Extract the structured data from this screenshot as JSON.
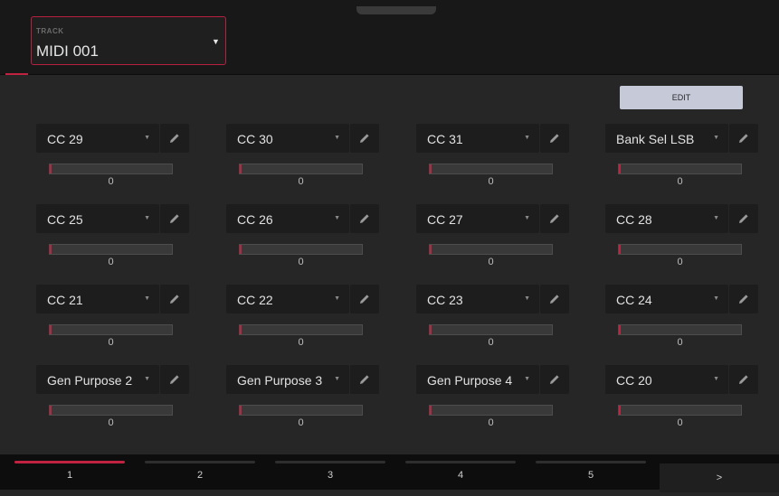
{
  "track": {
    "label": "TRACK",
    "value": "MIDI 001"
  },
  "edit_label": "EDIT",
  "rows": [
    [
      {
        "name": "CC 29",
        "value": "0",
        "level": 0
      },
      {
        "name": "CC 30",
        "value": "0",
        "level": 0
      },
      {
        "name": "CC 31",
        "value": "0",
        "level": 0
      },
      {
        "name": "Bank Sel LSB",
        "value": "0",
        "level": 0
      }
    ],
    [
      {
        "name": "CC 25",
        "value": "0",
        "level": 0
      },
      {
        "name": "CC 26",
        "value": "0",
        "level": 0
      },
      {
        "name": "CC 27",
        "value": "0",
        "level": 0
      },
      {
        "name": "CC 28",
        "value": "0",
        "level": 0
      }
    ],
    [
      {
        "name": "CC 21",
        "value": "0",
        "level": 0
      },
      {
        "name": "CC 22",
        "value": "0",
        "level": 0
      },
      {
        "name": "CC 23",
        "value": "0",
        "level": 0
      },
      {
        "name": "CC 24",
        "value": "0",
        "level": 0
      }
    ],
    [
      {
        "name": "Gen Purpose 2",
        "value": "0",
        "level": 0
      },
      {
        "name": "Gen Purpose 3",
        "value": "0",
        "level": 0
      },
      {
        "name": "Gen Purpose 4",
        "value": "0",
        "level": 0
      },
      {
        "name": "CC 20",
        "value": "0",
        "level": 0
      }
    ]
  ],
  "tabs": [
    "1",
    "2",
    "3",
    "4",
    "5"
  ],
  "active_tab": 0,
  "next_label": ">",
  "colors": {
    "accent": "#c0223f",
    "edit_button": "#c5c9d8"
  }
}
